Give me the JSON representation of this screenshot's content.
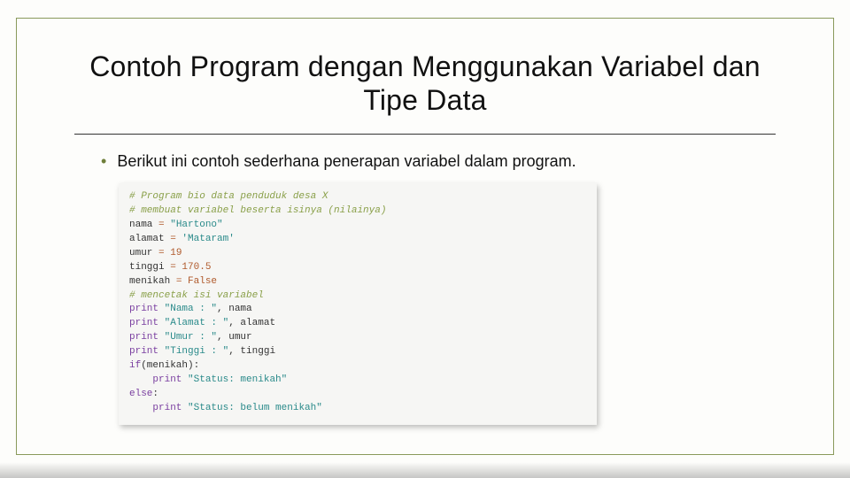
{
  "title": "Contoh Program dengan Menggunakan Variabel dan Tipe Data",
  "bullet": "Berikut ini contoh sederhana penerapan variabel dalam program.",
  "code": {
    "c1": "# Program bio data penduduk desa X",
    "c2": "# membuat variabel beserta isinya (nilainya)",
    "l3": {
      "var": "nama",
      "op": " = ",
      "val": "\"Hartono\""
    },
    "l4": {
      "var": "alamat",
      "op": " = ",
      "val": "'Mataram'"
    },
    "l5": {
      "var": "umur",
      "op": " = ",
      "val": "19"
    },
    "l6": {
      "var": "tinggi",
      "op": " = ",
      "val": "170.5"
    },
    "l7": {
      "var": "menikah",
      "op": " = ",
      "val": "False"
    },
    "c8": "# mencetak isi variabel",
    "l9": {
      "kw": "print",
      "s": " \"Nama : \"",
      "ar": ", nama"
    },
    "l10": {
      "kw": "print",
      "s": " \"Alamat : \"",
      "ar": ", alamat"
    },
    "l11": {
      "kw": "print",
      "s": " \"Umur : \"",
      "ar": ", umur"
    },
    "l12": {
      "kw": "print",
      "s": " \"Tinggi : \"",
      "ar": ", tinggi"
    },
    "l13": {
      "kw": "if",
      "cond": "(menikah):"
    },
    "l14": {
      "indent": "    ",
      "kw": "print",
      "s": " \"Status: menikah\""
    },
    "l15": {
      "kw": "else",
      "colon": ":"
    },
    "l16": {
      "indent": "    ",
      "kw": "print",
      "s": " \"Status: belum menikah\""
    }
  }
}
